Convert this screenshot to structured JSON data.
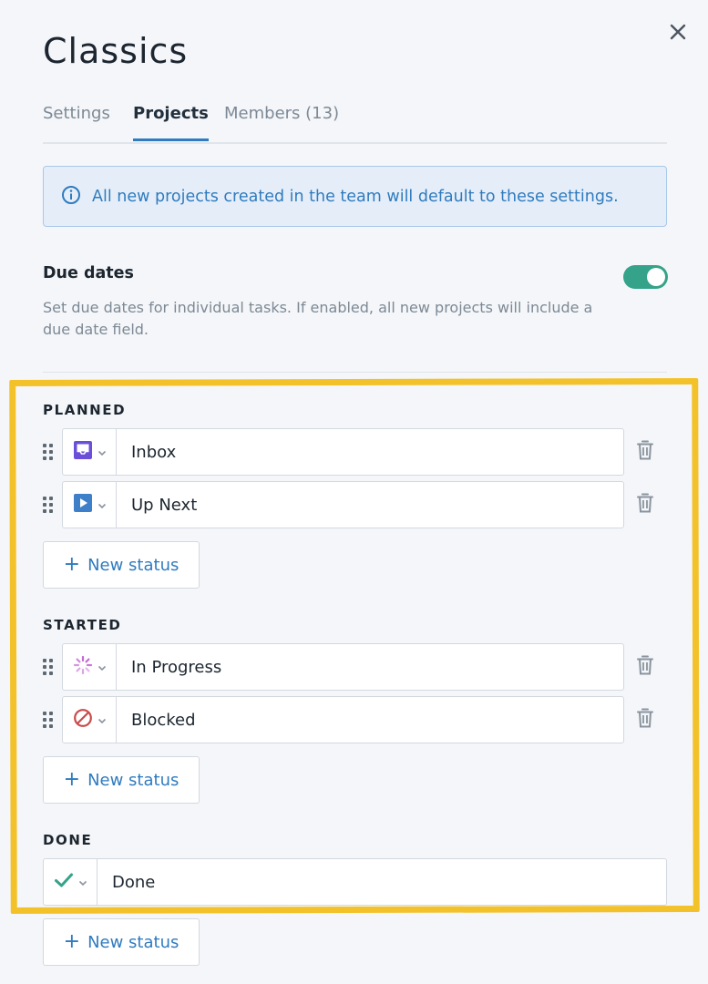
{
  "dialog": {
    "title": "Classics",
    "close_icon": "close-icon"
  },
  "tabs": [
    {
      "label": "Settings",
      "active": false
    },
    {
      "label": "Projects",
      "active": true
    },
    {
      "label": "Members (13)",
      "active": false
    }
  ],
  "info_banner": {
    "icon": "info-icon",
    "text": "All new projects created in the team will default to these settings."
  },
  "due_dates": {
    "title": "Due dates",
    "description": "Set due dates for individual tasks. If enabled, all new projects will include a due date field.",
    "enabled": true
  },
  "sections": {
    "planned": {
      "label": "PLANNED",
      "statuses": [
        {
          "name": "Inbox",
          "icon": "inbox-icon",
          "color": "#6b4fd8"
        },
        {
          "name": "Up Next",
          "icon": "play-icon",
          "color": "#3e7fc9"
        }
      ],
      "new_label": "New status"
    },
    "started": {
      "label": "STARTED",
      "statuses": [
        {
          "name": "In Progress",
          "icon": "progress-spinner-icon",
          "color": "#c46ad6"
        },
        {
          "name": "Blocked",
          "icon": "blocked-icon",
          "color": "#c94a4a"
        }
      ],
      "new_label": "New status"
    },
    "done": {
      "label": "DONE",
      "statuses": [
        {
          "name": "Done",
          "icon": "checkmark-icon",
          "color": "#34a38a"
        }
      ],
      "new_label": "New status"
    }
  },
  "colors": {
    "accent": "#2f7bbf",
    "toggle_on": "#34a38a",
    "highlight": "#f3c22a"
  }
}
